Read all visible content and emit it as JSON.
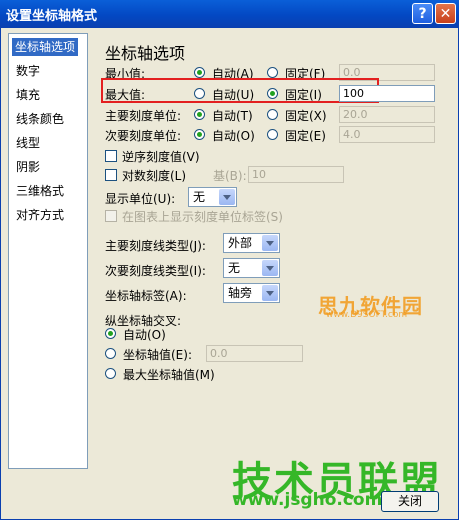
{
  "window": {
    "title": "设置坐标轴格式",
    "help_glyph": "?",
    "close_glyph": "✕"
  },
  "sidebar": {
    "items": [
      {
        "label": "坐标轴选项",
        "selected": true
      },
      {
        "label": "数字"
      },
      {
        "label": "填充"
      },
      {
        "label": "线条颜色"
      },
      {
        "label": "线型"
      },
      {
        "label": "阴影"
      },
      {
        "label": "三维格式"
      },
      {
        "label": "对齐方式"
      }
    ]
  },
  "axis_options": {
    "header": "坐标轴选项",
    "min": {
      "label": "最小值:",
      "auto": "自动(A)",
      "fixed": "固定(F)",
      "value": "0.0",
      "selected": "auto"
    },
    "max": {
      "label": "最大值:",
      "auto": "自动(U)",
      "fixed": "固定(I)",
      "value": "100",
      "selected": "fixed"
    },
    "major_unit": {
      "label": "主要刻度单位:",
      "auto": "自动(T)",
      "fixed": "固定(X)",
      "value": "20.0",
      "selected": "auto"
    },
    "minor_unit": {
      "label": "次要刻度单位:",
      "auto": "自动(O)",
      "fixed": "固定(E)",
      "value": "4.0",
      "selected": "auto"
    },
    "reverse": {
      "label": "逆序刻度值(V)",
      "checked": false
    },
    "log_scale": {
      "label": "对数刻度(L)",
      "base_label": "基(B):",
      "base_value": "10",
      "checked": false
    },
    "display_units": {
      "label": "显示单位(U):",
      "value": "无"
    },
    "show_units_label": {
      "label": "在图表上显示刻度单位标签(S)",
      "checked": false
    },
    "major_tick_type": {
      "label": "主要刻度线类型(J):",
      "value": "外部"
    },
    "minor_tick_type": {
      "label": "次要刻度线类型(I):",
      "value": "无"
    },
    "axis_labels": {
      "label": "坐标轴标签(A):",
      "value": "轴旁"
    },
    "cross": {
      "title": "纵坐标轴交叉:",
      "auto": "自动(O)",
      "axis_value": "坐标轴值(E):",
      "axis_value_input": "0.0",
      "max_value": "最大坐标轴值(M)",
      "selected": "auto"
    }
  },
  "footer": {
    "close_label": "关闭"
  },
  "watermarks": {
    "top_brand": "思九软件园",
    "top_url": "www.D9SOFT.com",
    "bottom_brand": "技术员联盟",
    "bottom_url": "www.jsgho.com"
  }
}
